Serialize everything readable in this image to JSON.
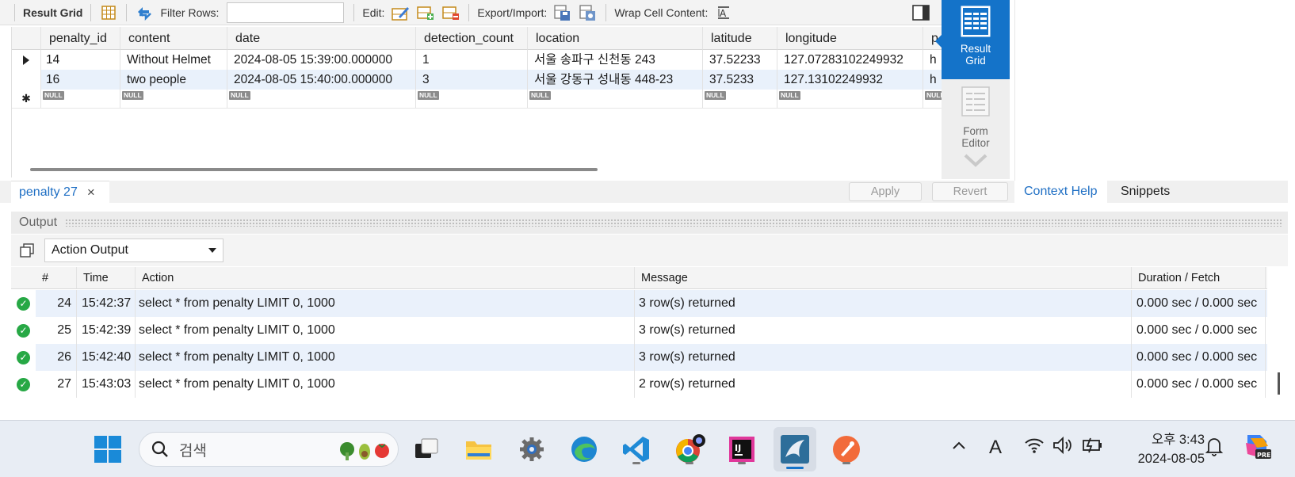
{
  "toolbar": {
    "result_grid_label": "Result Grid",
    "filter_label": "Filter Rows:",
    "filter_value": "",
    "edit_label": "Edit:",
    "export_label": "Export/Import:",
    "wrap_label": "Wrap Cell Content:"
  },
  "grid": {
    "columns": [
      "penalty_id",
      "content",
      "date",
      "detection_count",
      "location",
      "latitude",
      "longitude",
      "p"
    ],
    "rows": [
      [
        "14",
        "Without Helmet",
        "2024-08-05 15:39:00.000000",
        "1",
        "서울 송파구 신천동 243",
        "37.52233",
        "127.07283102249932",
        "h"
      ],
      [
        "16",
        "two people",
        "2024-08-05 15:40:00.000000",
        "3",
        "서울 강동구 성내동 448-23",
        "37.5233",
        "127.13102249932",
        "h"
      ]
    ],
    "null_label": "NULL"
  },
  "side_panel": {
    "result_grid": "Result Grid",
    "form_editor": "Form Editor"
  },
  "tabs": {
    "query_tab": "penalty 27",
    "apply": "Apply",
    "revert": "Revert",
    "context_help": "Context Help",
    "snippets": "Snippets"
  },
  "output": {
    "title": "Output",
    "selector": "Action Output",
    "columns": [
      "#",
      "Time",
      "Action",
      "Message",
      "Duration / Fetch"
    ],
    "rows": [
      {
        "num": "24",
        "time": "15:42:37",
        "action": "select * from penalty LIMIT 0, 1000",
        "message": "3 row(s) returned",
        "duration": "0.000 sec / 0.000 sec"
      },
      {
        "num": "25",
        "time": "15:42:39",
        "action": "select * from penalty LIMIT 0, 1000",
        "message": "3 row(s) returned",
        "duration": "0.000 sec / 0.000 sec"
      },
      {
        "num": "26",
        "time": "15:42:40",
        "action": "select * from penalty LIMIT 0, 1000",
        "message": "3 row(s) returned",
        "duration": "0.000 sec / 0.000 sec"
      },
      {
        "num": "27",
        "time": "15:43:03",
        "action": "select * from penalty LIMIT 0, 1000",
        "message": "2 row(s) returned",
        "duration": "0.000 sec / 0.000 sec"
      }
    ]
  },
  "taskbar": {
    "search_placeholder": "검색",
    "clock_time": "오후 3:43",
    "clock_date": "2024-08-05",
    "ime": "A"
  },
  "colors": {
    "accent": "#1473c9",
    "success": "#27a845"
  }
}
